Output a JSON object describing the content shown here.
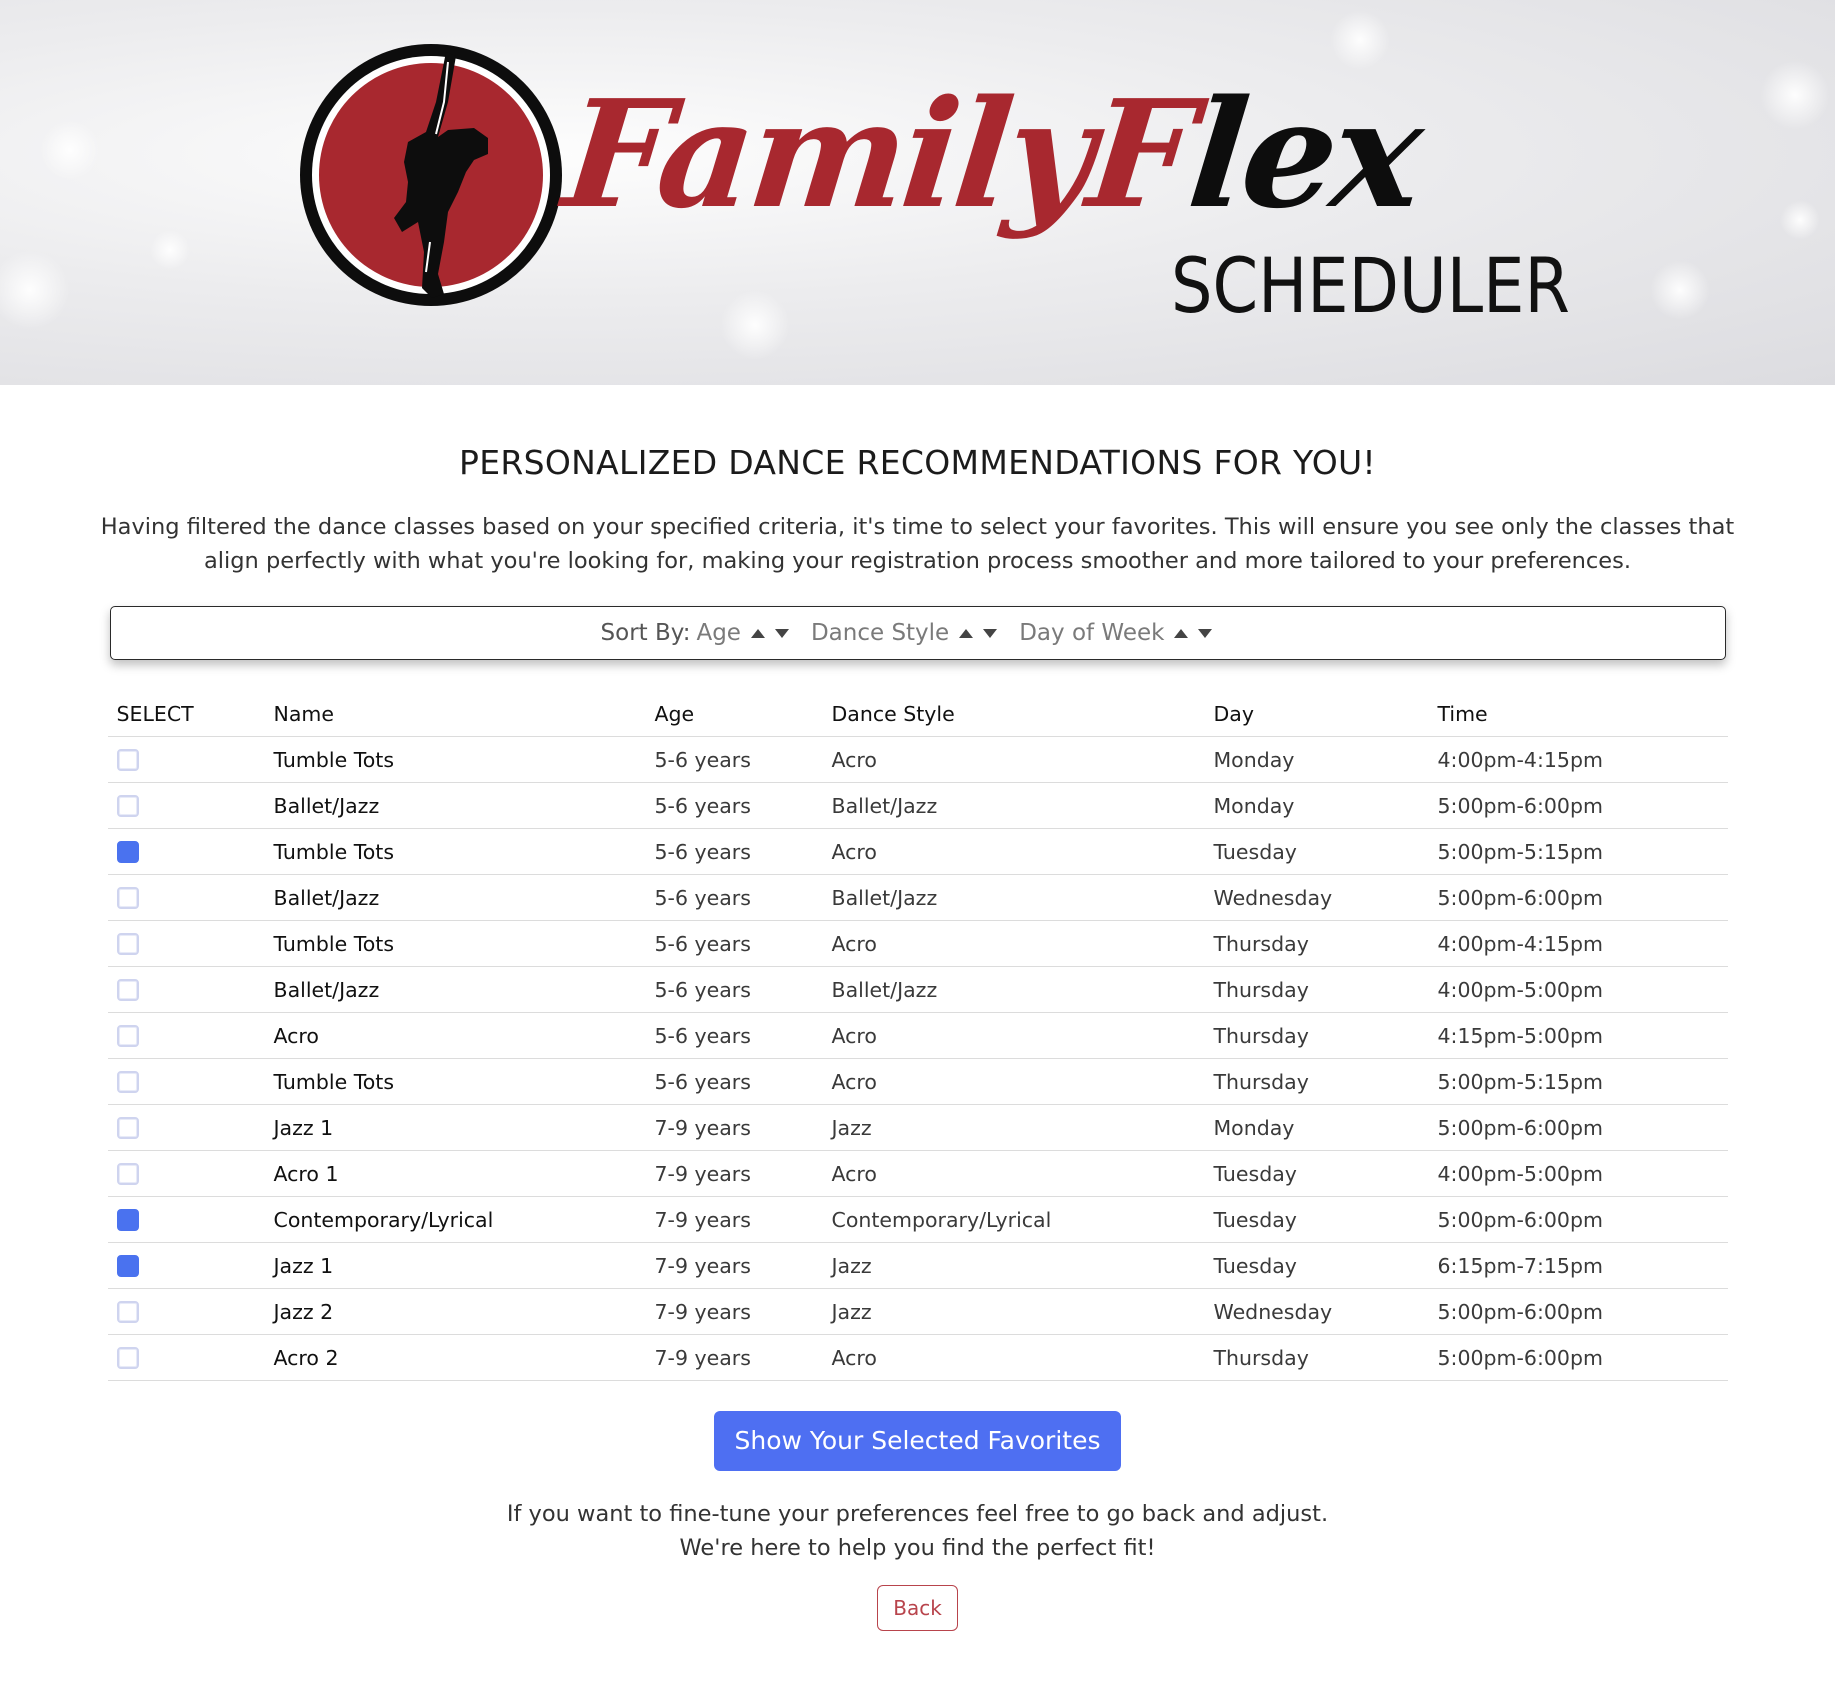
{
  "brand": {
    "word1": "Family",
    "word2_first": "F",
    "word2_rest": "lex",
    "subtitle": "SCHEDULER",
    "colors": {
      "red": "#a8282f",
      "black": "#0d0d0d"
    }
  },
  "page": {
    "heading": "PERSONALIZED DANCE RECOMMENDATIONS FOR YOU!",
    "intro": "Having filtered the dance classes based on your specified criteria, it's time to select your favorites. This will ensure you see only the classes that align perfectly with what you're looking for, making your registration process smoother and more tailored to your preferences."
  },
  "sort": {
    "label": "Sort By:",
    "options": [
      "Age",
      "Dance Style",
      "Day of Week"
    ]
  },
  "table": {
    "headers": [
      "SELECT",
      "Name",
      "Age",
      "Dance Style",
      "Day",
      "Time"
    ],
    "rows": [
      {
        "checked": false,
        "name": "Tumble Tots",
        "age": "5-6 years",
        "style": "Acro",
        "day": "Monday",
        "time": "4:00pm-4:15pm"
      },
      {
        "checked": false,
        "name": "Ballet/Jazz",
        "age": "5-6 years",
        "style": "Ballet/Jazz",
        "day": "Monday",
        "time": "5:00pm-6:00pm"
      },
      {
        "checked": true,
        "name": "Tumble Tots",
        "age": "5-6 years",
        "style": "Acro",
        "day": "Tuesday",
        "time": "5:00pm-5:15pm"
      },
      {
        "checked": false,
        "name": "Ballet/Jazz",
        "age": "5-6 years",
        "style": "Ballet/Jazz",
        "day": "Wednesday",
        "time": "5:00pm-6:00pm"
      },
      {
        "checked": false,
        "name": "Tumble Tots",
        "age": "5-6 years",
        "style": "Acro",
        "day": "Thursday",
        "time": "4:00pm-4:15pm"
      },
      {
        "checked": false,
        "name": "Ballet/Jazz",
        "age": "5-6 years",
        "style": "Ballet/Jazz",
        "day": "Thursday",
        "time": "4:00pm-5:00pm"
      },
      {
        "checked": false,
        "name": "Acro",
        "age": "5-6 years",
        "style": "Acro",
        "day": "Thursday",
        "time": "4:15pm-5:00pm"
      },
      {
        "checked": false,
        "name": "Tumble Tots",
        "age": "5-6 years",
        "style": "Acro",
        "day": "Thursday",
        "time": "5:00pm-5:15pm"
      },
      {
        "checked": false,
        "name": "Jazz 1",
        "age": "7-9 years",
        "style": "Jazz",
        "day": "Monday",
        "time": "5:00pm-6:00pm"
      },
      {
        "checked": false,
        "name": "Acro 1",
        "age": "7-9 years",
        "style": "Acro",
        "day": "Tuesday",
        "time": "4:00pm-5:00pm"
      },
      {
        "checked": true,
        "name": "Contemporary/Lyrical",
        "age": "7-9 years",
        "style": "Contemporary/Lyrical",
        "day": "Tuesday",
        "time": "5:00pm-6:00pm"
      },
      {
        "checked": true,
        "name": "Jazz 1",
        "age": "7-9 years",
        "style": "Jazz",
        "day": "Tuesday",
        "time": "6:15pm-7:15pm"
      },
      {
        "checked": false,
        "name": "Jazz 2",
        "age": "7-9 years",
        "style": "Jazz",
        "day": "Wednesday",
        "time": "5:00pm-6:00pm"
      },
      {
        "checked": false,
        "name": "Acro 2",
        "age": "7-9 years",
        "style": "Acro",
        "day": "Thursday",
        "time": "5:00pm-6:00pm"
      }
    ]
  },
  "actions": {
    "show_favorites": "Show Your Selected Favorites",
    "outro_line1": "If you want to fine-tune your preferences feel free to go back and adjust.",
    "outro_line2": "We're here to help you find the perfect fit!",
    "back": "Back"
  },
  "colors": {
    "primary": "#4e6ff2",
    "checkbox_checked": "#4a72ef",
    "back_border": "#b8444c"
  }
}
